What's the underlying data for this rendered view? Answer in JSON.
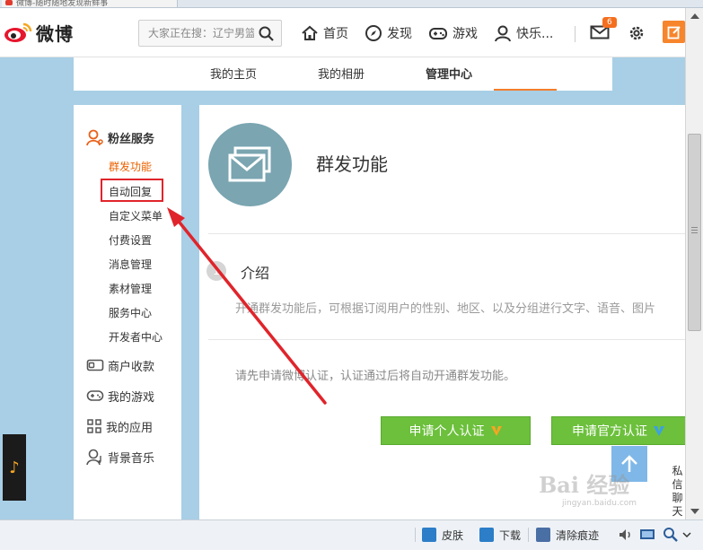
{
  "browser_tab": {
    "title": "微博-随时随地发现新鲜事"
  },
  "header": {
    "logo_text": "微博",
    "search_placeholder": "大家正在搜：辽宁男篮",
    "nav": [
      {
        "label": "首页",
        "icon": "home-icon"
      },
      {
        "label": "发现",
        "icon": "compass-icon"
      },
      {
        "label": "游戏",
        "icon": "gamepad-icon"
      },
      {
        "label": "快乐...",
        "icon": "user-icon"
      }
    ],
    "mail_badge": "6"
  },
  "profile_tabs": [
    {
      "label": "我的主页"
    },
    {
      "label": "我的相册"
    },
    {
      "label": "管理中心",
      "active": true
    }
  ],
  "sidebar": {
    "fans_service": {
      "title": "粉丝服务",
      "items": [
        "群发功能",
        "自动回复",
        "自定义菜单",
        "付费设置",
        "消息管理",
        "素材管理",
        "服务中心",
        "开发者中心"
      ]
    },
    "menu": [
      {
        "label": "商户收款",
        "icon": "wallet-icon"
      },
      {
        "label": "我的游戏",
        "icon": "gamepad-icon"
      },
      {
        "label": "我的应用",
        "icon": "apps-grid-icon"
      },
      {
        "label": "背景音乐",
        "icon": "music-user-icon"
      }
    ]
  },
  "main": {
    "title": "群发功能",
    "intro": {
      "number": "1",
      "title": "介绍",
      "desc": "开通群发功能后，可根据订阅用户的性别、地区、以及分组进行文字、语音、图片"
    },
    "notice": "请先申请微博认证，认证通过后将自动开通群发功能。",
    "buttons": [
      {
        "label": "申请个人认证",
        "badge_color": "#f5a623"
      },
      {
        "label": "申请官方认证",
        "badge_color": "#3aa0e8"
      }
    ]
  },
  "floating": {
    "private_msg": "私信聊天",
    "music_glyph": "♪"
  },
  "watermark": {
    "text": "Bai 经验",
    "sub": "jingyan.baidu.com"
  },
  "statusbar": {
    "items": [
      {
        "label": "皮肤",
        "color": "#2c7ec8"
      },
      {
        "label": "下载",
        "color": "#2c7ec8"
      },
      {
        "label": "清除痕迹",
        "color": "#4a6fa5"
      }
    ]
  },
  "colors": {
    "accent_orange": "#f47e2c",
    "highlight_red": "#e0242b",
    "button_green": "#6cc03c",
    "icon_circle": "#7aa5b1"
  }
}
